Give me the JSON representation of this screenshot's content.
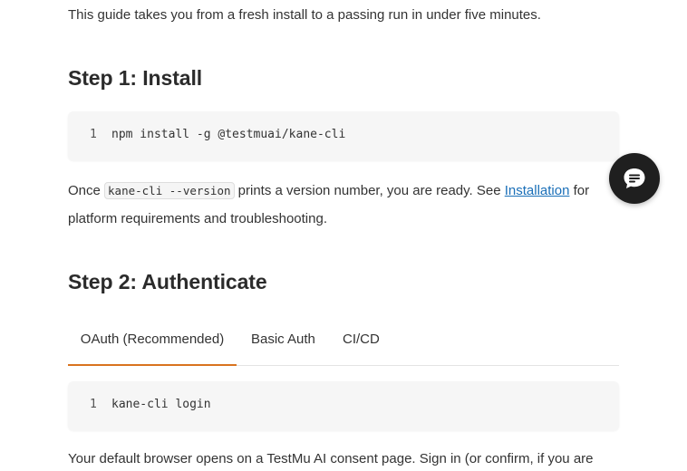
{
  "intro": "This guide takes you from a fresh install to a passing run in under five minutes.",
  "step1": {
    "heading": "Step 1: Install",
    "code_line_number": "1",
    "code": "npm install -g @testmuai/kane-cli"
  },
  "once_paragraph": {
    "before": "Once ",
    "inline_code": "kane-cli --version",
    "middle": " prints a version number, you are ready. See ",
    "link_text": "Installation",
    "after": " for platform requirements and troubleshooting."
  },
  "step2": {
    "heading": "Step 2: Authenticate",
    "tabs": [
      {
        "label": "OAuth (Recommended)",
        "active": true
      },
      {
        "label": "Basic Auth",
        "active": false
      },
      {
        "label": "CI/CD",
        "active": false
      }
    ],
    "code_line_number": "1",
    "code": "kane-cli login"
  },
  "last_paragraph": "Your default browser opens on a TestMu AI consent page. Sign in (or confirm, if you are",
  "chat_widget": {
    "icon": "chat-bubble-icon",
    "background": "#1f1f1f"
  },
  "colors": {
    "accent": "#d9731f",
    "link": "#1a6fb8"
  }
}
